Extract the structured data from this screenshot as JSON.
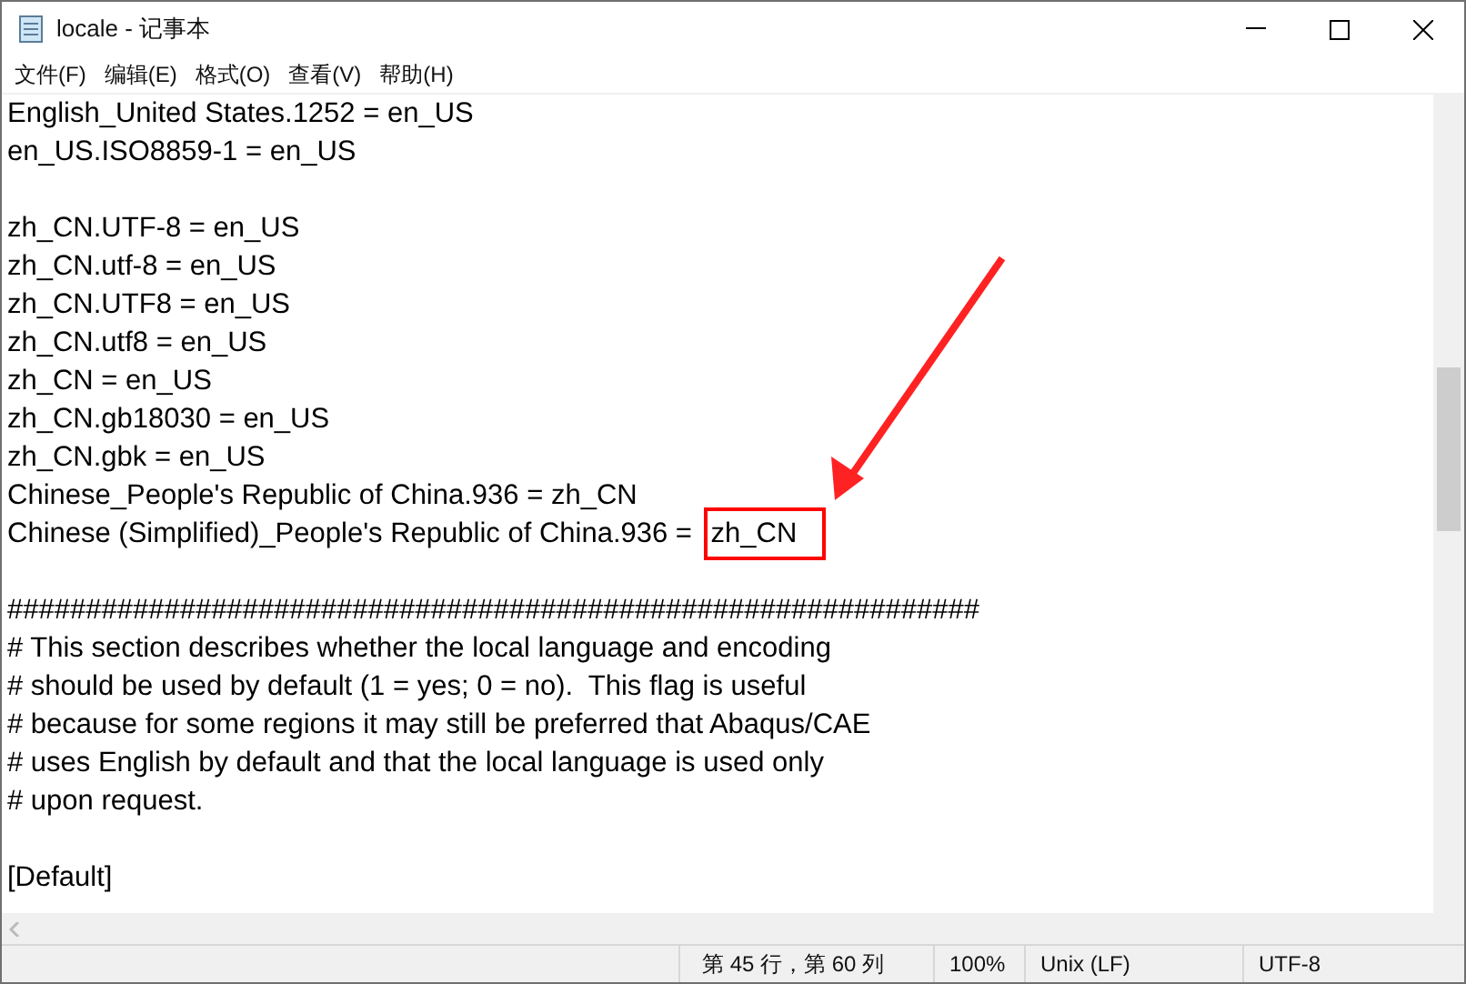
{
  "window": {
    "title": "locale - 记事本"
  },
  "menu": [
    "文件(F)",
    "编辑(E)",
    "格式(O)",
    "查看(V)",
    "帮助(H)"
  ],
  "blocks": [
    {
      "lines": [
        {
          "text": "English_United States.1252 = en_US"
        },
        {
          "text": "en_US.ISO8859-1 = en_US"
        }
      ]
    },
    {
      "lines": [
        {
          "text": "zh_CN.UTF-8 = en_US"
        },
        {
          "text": "zh_CN.utf-8 = en_US"
        },
        {
          "text": "zh_CN.UTF8 = en_US"
        },
        {
          "text": "zh_CN.utf8 = en_US"
        },
        {
          "text": "zh_CN = en_US"
        },
        {
          "text": "zh_CN.gb18030 = en_US"
        },
        {
          "text": "zh_CN.gbk = en_US"
        },
        {
          "text": "Chinese_People's Republic of China.936 = zh_CN"
        },
        {
          "text": "Chinese (Simplified)_People's Republic of China.936 = ",
          "highlight": "zh_CN"
        }
      ]
    },
    {
      "lines": [
        {
          "text": "##############################################################"
        },
        {
          "text": "# This section describes whether the local language and encoding"
        },
        {
          "text": "# should be used by default (1 = yes; 0 = no).  This flag is useful"
        },
        {
          "text": "# because for some regions it may still be preferred that Abaqus/CAE"
        },
        {
          "text": "# uses English by default and that the local language is used only"
        },
        {
          "text": "# upon request."
        }
      ]
    },
    {
      "lines": [
        {
          "text": "[Default]"
        }
      ]
    }
  ],
  "status_bar": {
    "position": "第 45 行，第 60 列",
    "zoom": "100%",
    "line_ending": "Unix (LF)",
    "encoding": "UTF-8"
  }
}
